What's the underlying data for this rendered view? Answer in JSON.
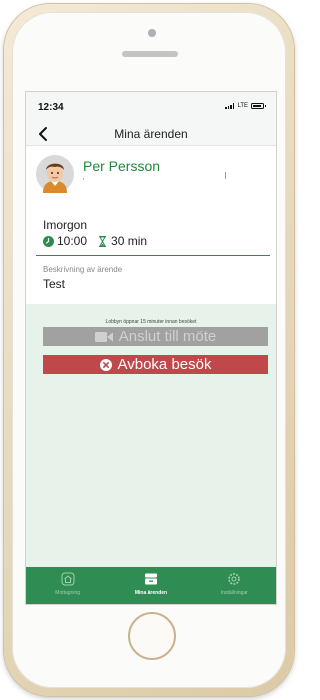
{
  "status_bar": {
    "time": "12:34",
    "network": "LTE"
  },
  "nav": {
    "title": "Mina ärenden"
  },
  "appointment": {
    "person_name": "Per Persson",
    "person_sub": "'",
    "day": "Imorgon",
    "time": "10:00",
    "duration": "30 min",
    "description_label": "Beskrivning av ärende",
    "description_value": "Test"
  },
  "actions": {
    "lobby_note": "Lobbyn öppnar 15 minuter innan besöket",
    "join_label": "Anslut till möte",
    "cancel_label": "Avboka besök"
  },
  "tabs": [
    {
      "label": "Mottagning",
      "icon": "home-icon"
    },
    {
      "label": "Mina ärenden",
      "icon": "inbox-icon",
      "active": true
    },
    {
      "label": "Inställningar",
      "icon": "gear-icon"
    }
  ],
  "colors": {
    "brand_green": "#2f8c52",
    "name_green": "#1f8a3c",
    "cancel_red": "#c0474a",
    "disabled_gray": "#a1a1a1",
    "screen_bg": "#e7f2ea"
  }
}
